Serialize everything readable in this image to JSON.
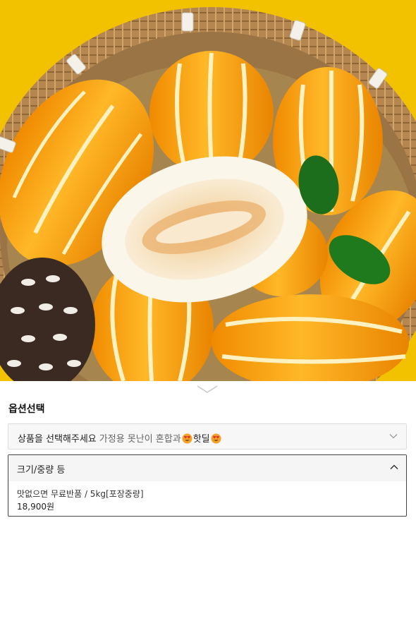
{
  "hero": {
    "image_name": "korean-melon-basket-photo",
    "colors": {
      "background": "#f2c200",
      "melon": "#f6a81c",
      "basket": "#b8894f"
    }
  },
  "options": {
    "title": "옵션선택",
    "select": {
      "placeholder": "상품을 선택해주세요",
      "subtext_1": "가정용 못난이 혼합과",
      "subtext_2": "핫딜",
      "emoji_icon": "heart-eyes-emoji-icon",
      "chevron_icon": "chevron-down-icon"
    },
    "group": {
      "label": "크기/중량 등",
      "chevron_icon": "chevron-up-icon",
      "items": [
        {
          "name": "맛없으면 무료반품 / 5kg[포장중량]",
          "price": "18,900원"
        }
      ]
    }
  }
}
